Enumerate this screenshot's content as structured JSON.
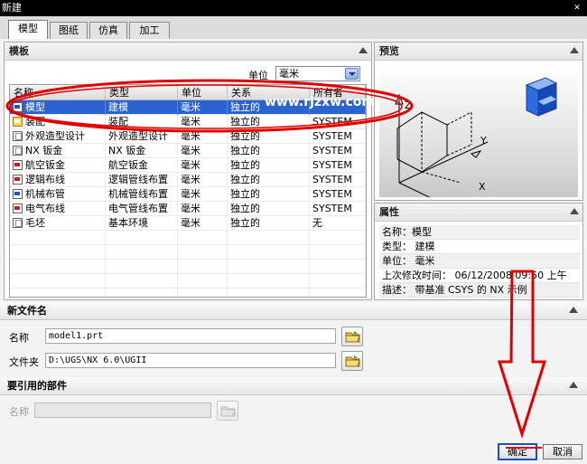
{
  "window": {
    "title": "新建"
  },
  "tabs": [
    {
      "label": "模型"
    },
    {
      "label": "图纸"
    },
    {
      "label": "仿真"
    },
    {
      "label": "加工"
    }
  ],
  "templates": {
    "header": "模板",
    "unit_label": "单位",
    "unit_value": "毫米",
    "columns": [
      "名称",
      "类型",
      "单位",
      "关系",
      "所有者"
    ],
    "rows": [
      {
        "icon": "model-icon",
        "name": "模型",
        "type": "建模",
        "unit": "毫米",
        "relation": "独立的",
        "owner": "",
        "selected": true
      },
      {
        "icon": "assembly-icon",
        "name": "装配",
        "type": "装配",
        "unit": "毫米",
        "relation": "独立的",
        "owner": "SYSTEM"
      },
      {
        "icon": "shape-studio-icon",
        "name": "外观造型设计",
        "type": "外观造型设计",
        "unit": "毫米",
        "relation": "独立的",
        "owner": "SYSTEM"
      },
      {
        "icon": "sheet-metal-icon",
        "name": "NX 钣金",
        "type": "NX 钣金",
        "unit": "毫米",
        "relation": "独立的",
        "owner": "SYSTEM"
      },
      {
        "icon": "aero-sheet-metal-icon",
        "name": "航空钣金",
        "type": "航空钣金",
        "unit": "毫米",
        "relation": "独立的",
        "owner": "SYSTEM"
      },
      {
        "icon": "logical-routing-icon",
        "name": "逻辑布线",
        "type": "逻辑管线布置",
        "unit": "毫米",
        "relation": "独立的",
        "owner": "SYSTEM"
      },
      {
        "icon": "mechanical-routing-icon",
        "name": "机械布管",
        "type": "机械管线布置",
        "unit": "毫米",
        "relation": "独立的",
        "owner": "SYSTEM"
      },
      {
        "icon": "electrical-routing-icon",
        "name": "电气布线",
        "type": "电气管线布置",
        "unit": "毫米",
        "relation": "独立的",
        "owner": "SYSTEM"
      },
      {
        "icon": "blank-icon",
        "name": "毛坯",
        "type": "基本环境",
        "unit": "毫米",
        "relation": "独立的",
        "owner": "无"
      }
    ]
  },
  "watermark": "www.rjzxw.com",
  "preview": {
    "header": "预览",
    "axis_x": "X",
    "axis_y": "Y",
    "axis_z": "Z"
  },
  "properties": {
    "header": "属性",
    "items": [
      "名称：模型",
      "类型： 建模",
      "单位： 毫米",
      "上次修改时间： 06/12/2008 09:50 上午",
      "描述： 带基准 CSYS 的 NX 示例"
    ]
  },
  "new_file": {
    "header": "新文件名",
    "name_label": "名称",
    "name_value": "model1.prt",
    "folder_label": "文件夹",
    "folder_value": "D:\\UGS\\NX 6.0\\UGII"
  },
  "reference": {
    "header": "要引用的部件",
    "name_label": "名称",
    "name_value": ""
  },
  "buttons": {
    "ok": "确定",
    "cancel": "取消"
  },
  "colors": {
    "selection": "#2a63d0",
    "annotation": "#e00000",
    "watermark": "#ffffff"
  }
}
